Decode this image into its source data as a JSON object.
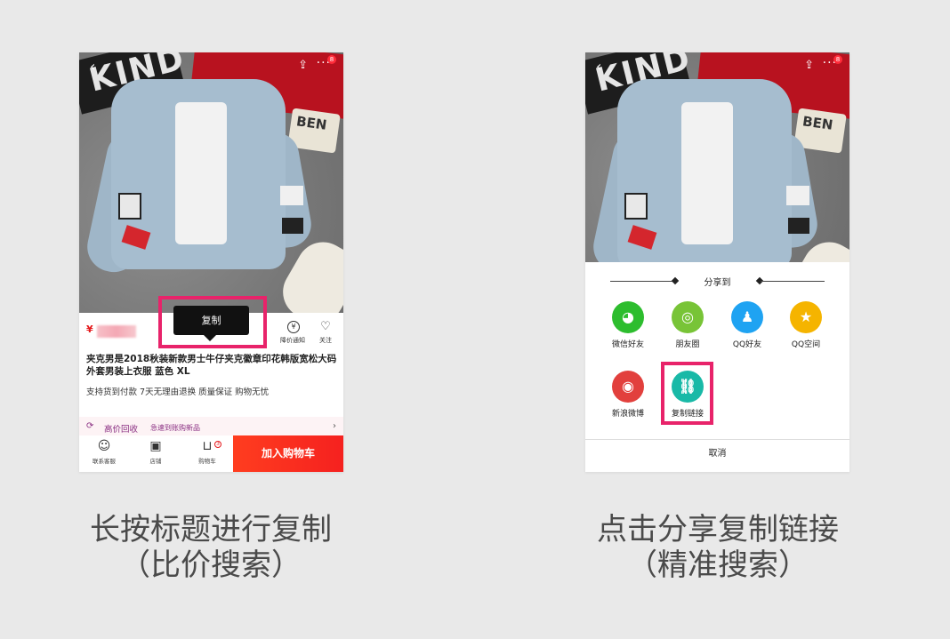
{
  "left_phone": {
    "cart_badge": "8",
    "price_symbol": "¥",
    "actions": [
      {
        "icon": "¥",
        "label": "降价通知"
      },
      {
        "icon": "♡",
        "label": "关注"
      }
    ],
    "title": "夹克男是2018秋装新款男士牛仔夹克徽章印花韩版宽松大码外套男装上衣服 蓝色 XL",
    "guarantee": "支持货到付款 7天无理由退换 质量保证 购物无忧",
    "recycle": {
      "label": "高价回收",
      "sub": "急速到账购新品"
    },
    "bottom_nav": [
      "联系客服",
      "店铺",
      "购物车"
    ],
    "cart_count": "3",
    "add_to_cart": "加入购物车",
    "tooltip": "复制"
  },
  "right_phone": {
    "cart_badge": "8",
    "share_title": "分享到",
    "share_items": [
      {
        "label": "微信好友",
        "color": "#2dbd2e",
        "icon": "wechat-icon"
      },
      {
        "label": "朋友圈",
        "color": "#78c437",
        "icon": "moments-icon"
      },
      {
        "label": "QQ好友",
        "color": "#1fa3f2",
        "icon": "qq-icon"
      },
      {
        "label": "QQ空间",
        "color": "#f5b400",
        "icon": "qzone-icon"
      },
      {
        "label": "新浪微博",
        "color": "#e2403d",
        "icon": "weibo-icon"
      },
      {
        "label": "复制链接",
        "color": "#19b9a7",
        "icon": "link-icon"
      }
    ],
    "cancel": "取消"
  },
  "captions": {
    "left_line1": "长按标题进行复制",
    "left_line2": "（比价搜索）",
    "right_line1": "点击分享复制链接",
    "right_line2": "（精准搜索）"
  },
  "highlight_color": "#e8236a"
}
